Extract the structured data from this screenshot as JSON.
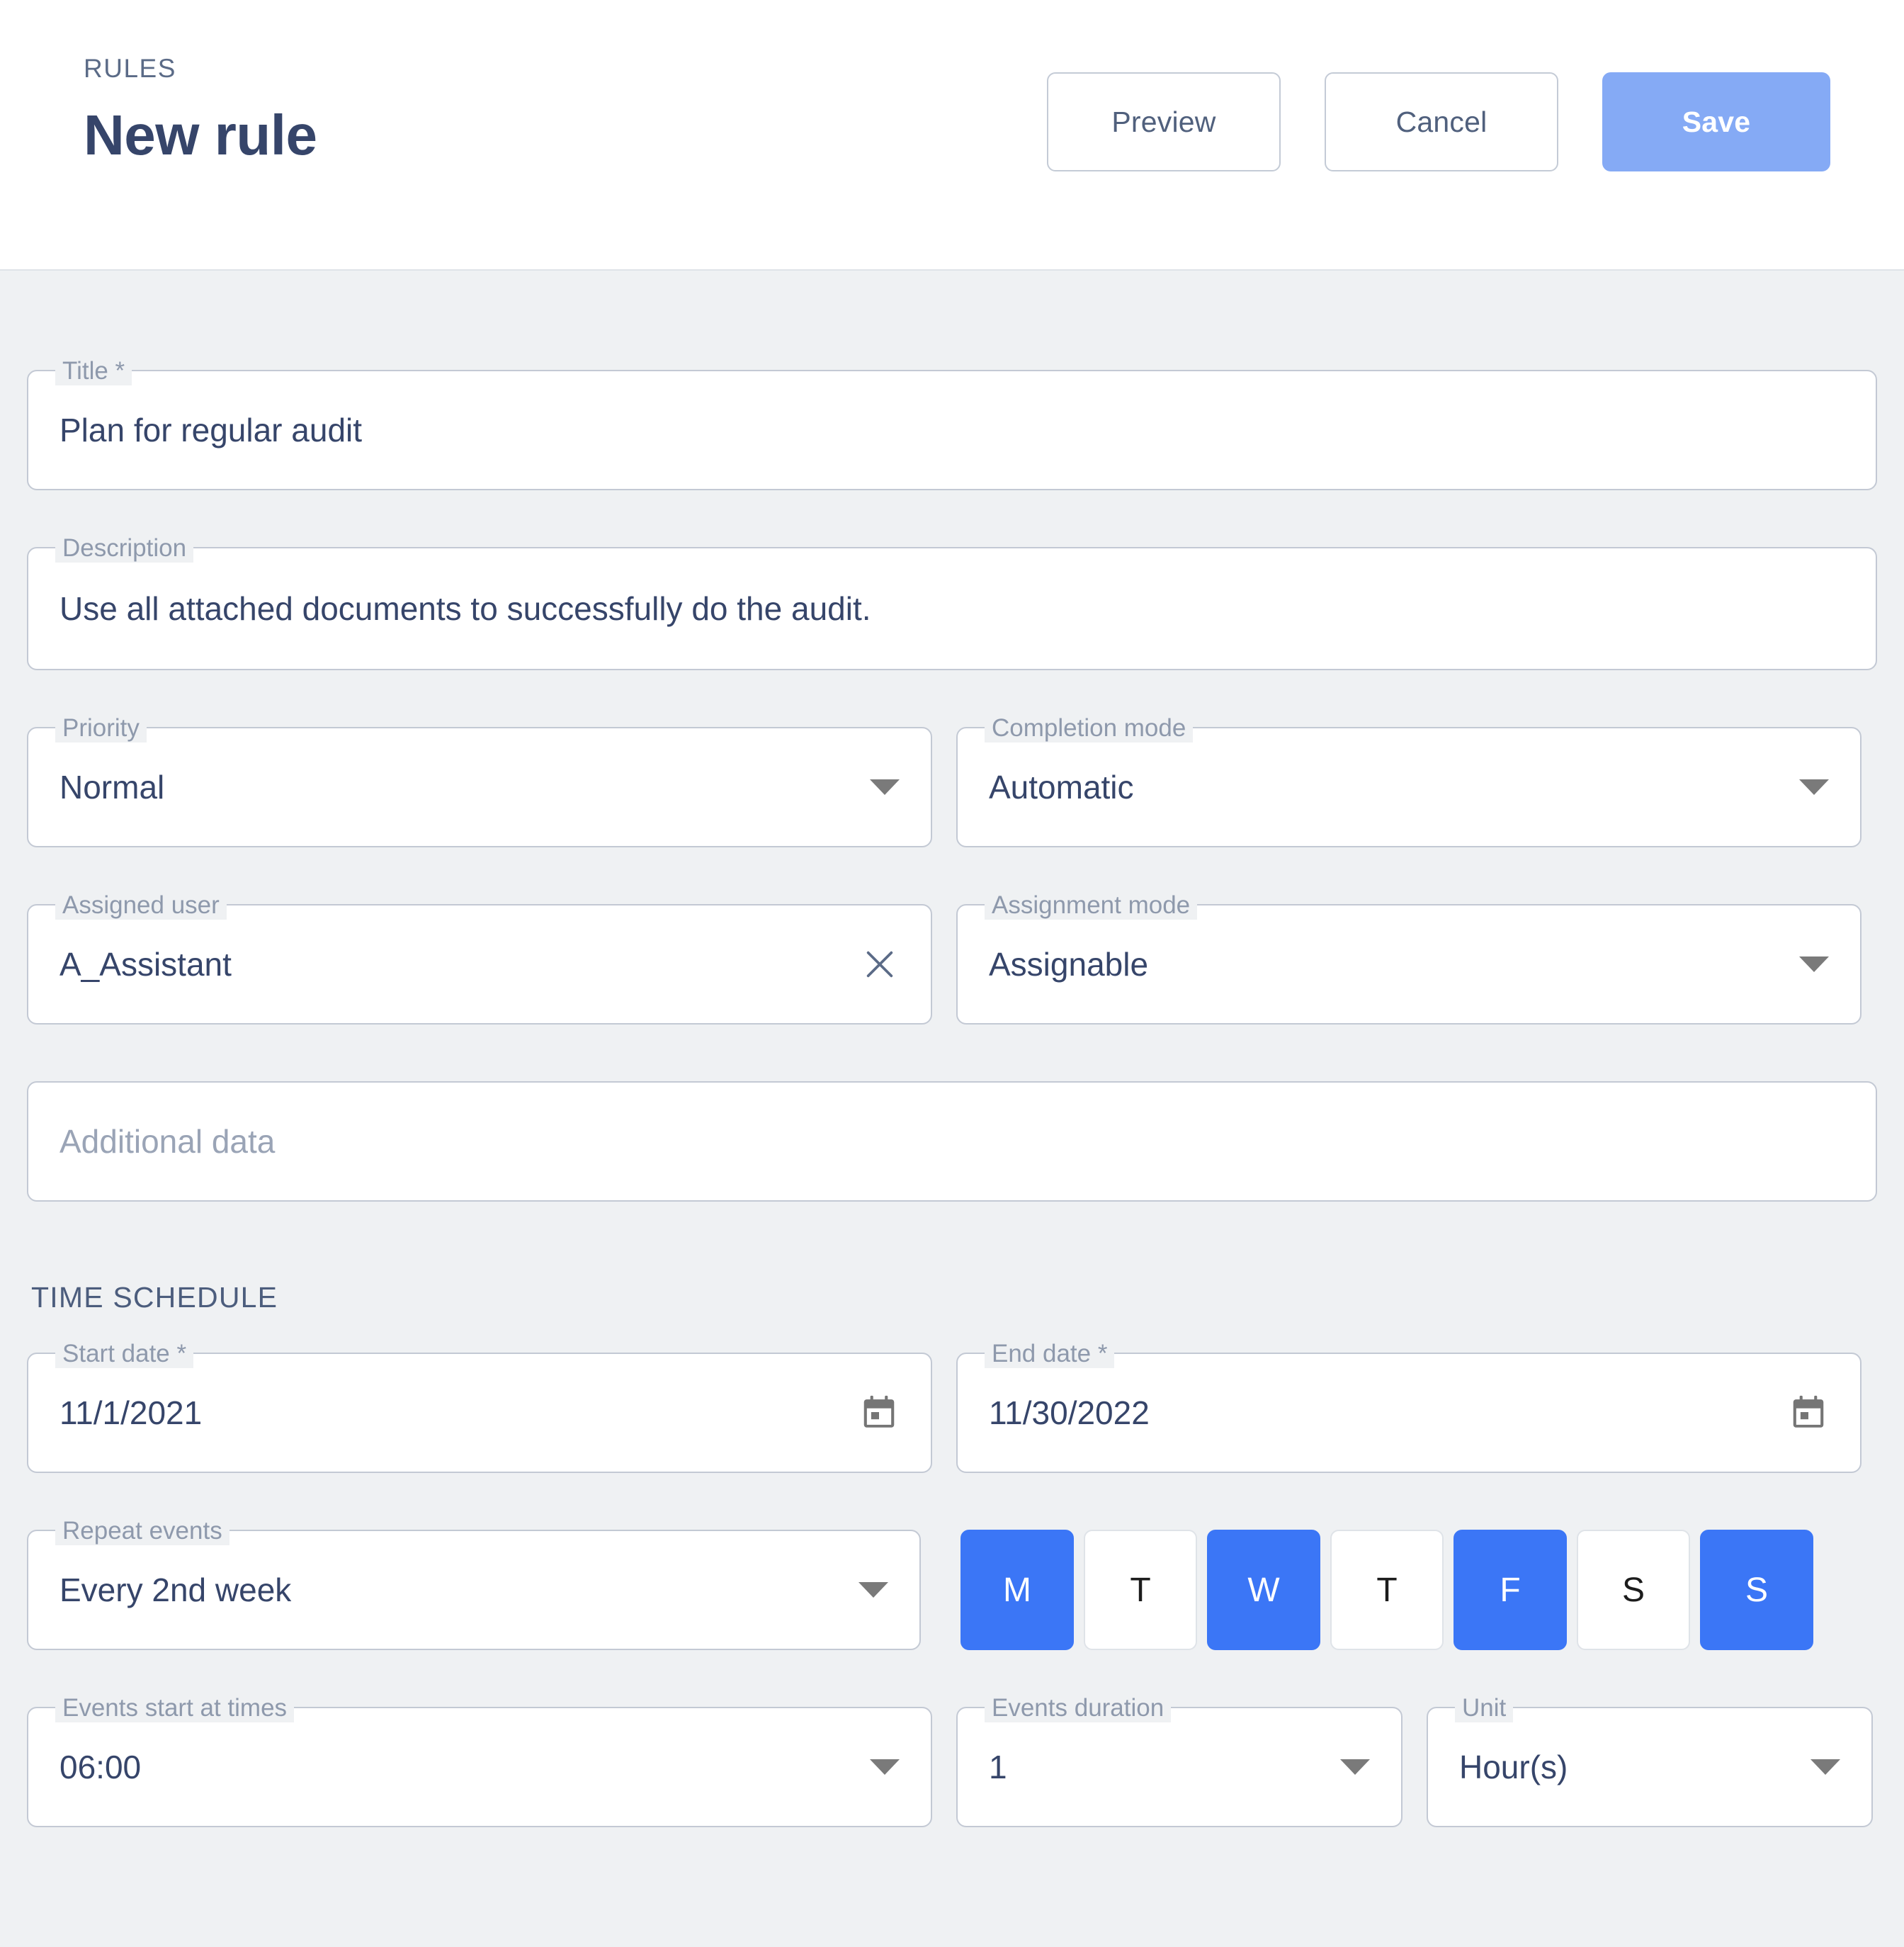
{
  "header": {
    "eyebrow": "RULES",
    "title": "New rule",
    "preview_label": "Preview",
    "cancel_label": "Cancel",
    "save_label": "Save",
    "save_color": "#85aaf5"
  },
  "form": {
    "title_field": {
      "label": "Title *",
      "value": "Plan for regular audit"
    },
    "description_field": {
      "label": "Description",
      "value": "Use all attached documents to successfully do the audit."
    },
    "priority_field": {
      "label": "Priority",
      "value": "Normal"
    },
    "completion_mode_field": {
      "label": "Completion mode",
      "value": "Automatic"
    },
    "assigned_user_field": {
      "label": "Assigned user",
      "value": "A_Assistant"
    },
    "assignment_mode_field": {
      "label": "Assignment mode",
      "value": "Assignable"
    },
    "additional_data_field": {
      "placeholder": "Additional data",
      "value": ""
    }
  },
  "time_schedule": {
    "section_title": "TIME SCHEDULE",
    "start_date_field": {
      "label": "Start date *",
      "value": "11/1/2021"
    },
    "end_date_field": {
      "label": "End date *",
      "value": "11/30/2022"
    },
    "repeat_events_field": {
      "label": "Repeat events",
      "value": "Every 2nd week"
    },
    "events_start_field": {
      "label": "Events start at times",
      "value": "06:00"
    },
    "events_duration_field": {
      "label": "Events duration",
      "value": "1"
    },
    "unit_field": {
      "label": "Unit",
      "value": "Hour(s)"
    },
    "selected_color": "#3b76f6",
    "days": [
      {
        "label": "M",
        "name": "monday",
        "selected": true
      },
      {
        "label": "T",
        "name": "tuesday",
        "selected": false
      },
      {
        "label": "W",
        "name": "wednesday",
        "selected": true
      },
      {
        "label": "T",
        "name": "thursday",
        "selected": false
      },
      {
        "label": "F",
        "name": "friday",
        "selected": true
      },
      {
        "label": "S",
        "name": "saturday",
        "selected": false
      },
      {
        "label": "S",
        "name": "sunday",
        "selected": true
      }
    ]
  }
}
